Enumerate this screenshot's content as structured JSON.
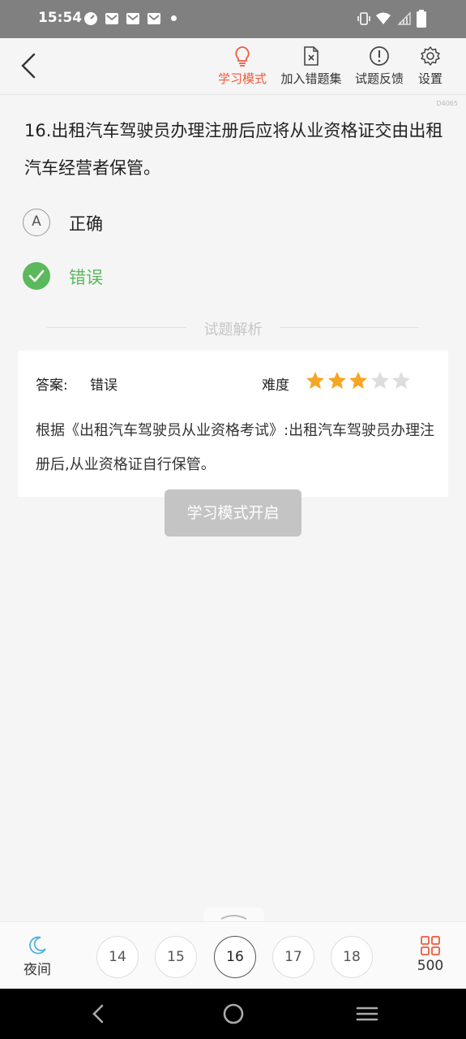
{
  "status_bar": {
    "time": "15:54",
    "icons": [
      "speedometer-icon",
      "mail-icon",
      "mail-icon",
      "mail-icon",
      "dot-icon",
      "vibrate-icon",
      "wifi-icon",
      "signal-icon",
      "battery-icon"
    ]
  },
  "header": {
    "tools": [
      {
        "label": "学习模式",
        "icon": "lightbulb-icon",
        "active": true
      },
      {
        "label": "加入错题集",
        "icon": "document-x-icon",
        "active": false
      },
      {
        "label": "试题反馈",
        "icon": "exclamation-circle-icon",
        "active": false
      },
      {
        "label": "设置",
        "icon": "gear-icon",
        "active": false
      }
    ]
  },
  "question": {
    "id_code": "D4065",
    "text": "16.出租汽车驾驶员办理注册后应将从业资格证交由出租汽车经营者保管。",
    "options": [
      {
        "badge": "A",
        "text": "正确",
        "state": "normal"
      },
      {
        "badge": "",
        "text": "错误",
        "state": "correct"
      }
    ]
  },
  "analysis": {
    "section_title": "试题解析",
    "answer_label": "答案:",
    "answer_value": "错误",
    "difficulty_label": "难度",
    "difficulty_stars": 3,
    "difficulty_max": 5,
    "text": "根据《出租汽车驾驶员从业资格考试》:出租汽车驾驶员办理注册后,从业资格证自行保管。"
  },
  "toast": "学习模式开启",
  "bottom_bar": {
    "night_label": "夜间",
    "pages": [
      "14",
      "15",
      "16",
      "17",
      "18"
    ],
    "current_page": "16",
    "total": "500"
  },
  "colors": {
    "accent": "#f05a3c",
    "correct": "#5cb85c",
    "star_on": "#f5a623",
    "star_off": "#dddddd",
    "night_icon": "#4fb3d9"
  }
}
